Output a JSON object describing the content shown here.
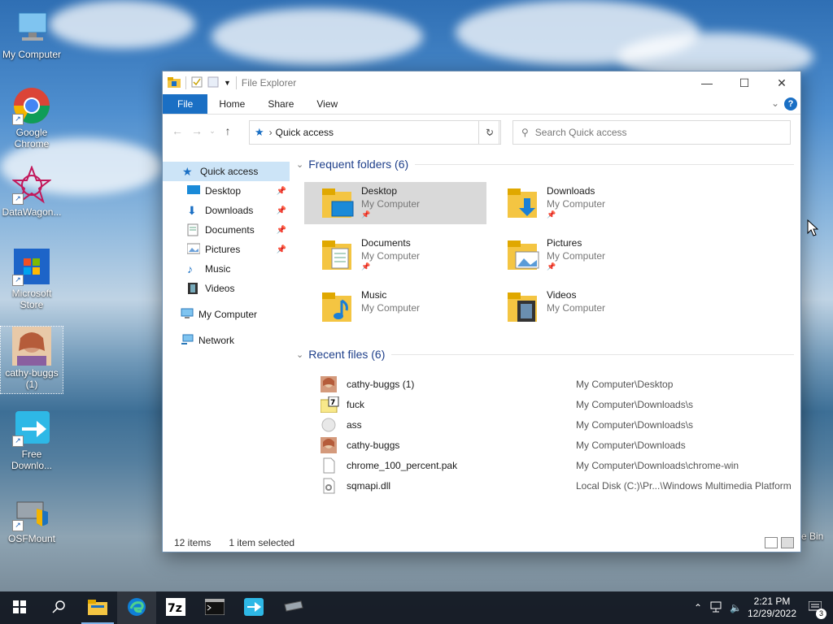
{
  "desktop": {
    "icons": [
      {
        "label": "My Computer"
      },
      {
        "label": "Google Chrome"
      },
      {
        "label": "DataWagon..."
      },
      {
        "label": "Microsoft Store"
      },
      {
        "label": "cathy-buggs (1)"
      },
      {
        "label": "Free Downlo..."
      },
      {
        "label": "OSFMount"
      }
    ],
    "recycle_label": "e Bin"
  },
  "window": {
    "title": "File Explorer",
    "ribbon_tabs": [
      "File",
      "Home",
      "Share",
      "View"
    ],
    "help_label": "?",
    "address": "Quick access",
    "search_placeholder": "Search Quick access",
    "nav": {
      "quick_access": "Quick access",
      "items": [
        "Desktop",
        "Downloads",
        "Documents",
        "Pictures",
        "Music",
        "Videos"
      ],
      "my_computer": "My Computer",
      "network": "Network"
    },
    "frequent": {
      "header": "Frequent folders (6)",
      "folders": [
        {
          "name": "Desktop",
          "location": "My Computer"
        },
        {
          "name": "Downloads",
          "location": "My Computer"
        },
        {
          "name": "Documents",
          "location": "My Computer"
        },
        {
          "name": "Pictures",
          "location": "My Computer"
        },
        {
          "name": "Music",
          "location": "My Computer"
        },
        {
          "name": "Videos",
          "location": "My Computer"
        }
      ]
    },
    "recent": {
      "header": "Recent files (6)",
      "files": [
        {
          "name": "cathy-buggs (1)",
          "location": "My Computer\\Desktop"
        },
        {
          "name": "fuck",
          "location": "My Computer\\Downloads\\s"
        },
        {
          "name": "ass",
          "location": "My Computer\\Downloads\\s"
        },
        {
          "name": "cathy-buggs",
          "location": "My Computer\\Downloads"
        },
        {
          "name": "chrome_100_percent.pak",
          "location": "My Computer\\Downloads\\chrome-win"
        },
        {
          "name": "sqmapi.dll",
          "location": "Local Disk (C:)\\Pr...\\Windows Multimedia Platform"
        }
      ]
    },
    "status": {
      "count": "12 items",
      "selected": "1 item selected"
    }
  },
  "taskbar": {
    "time": "2:21 PM",
    "date": "12/29/2022",
    "notification_count": "3"
  },
  "colors": {
    "accent": "#1a6fc4",
    "folder": "#f4c542",
    "selection": "#cce4f7"
  }
}
